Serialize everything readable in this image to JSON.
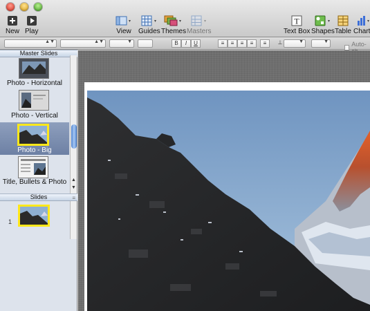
{
  "toolbar": {
    "new_label": "New",
    "play_label": "Play",
    "view_label": "View",
    "guides_label": "Guides",
    "themes_label": "Themes",
    "masters_label": "Masters",
    "textbox_label": "Text Box",
    "textbox_icon_glyph": "T",
    "shapes_label": "Shapes",
    "table_label": "Table",
    "charts_label": "Charts"
  },
  "formatbar": {
    "bold": "B",
    "italic": "I",
    "underline": "U",
    "autoshrink_label": "Auto-sh"
  },
  "sidebar": {
    "master_header": "Master Slides",
    "masters": [
      {
        "label": "Photo - Horizontal"
      },
      {
        "label": "Photo - Vertical"
      },
      {
        "label": "Photo - Big",
        "selected": true
      },
      {
        "label": "Title, Bullets & Photo"
      }
    ],
    "slides_header": "Slides",
    "slides": [
      {
        "number": "1",
        "selected": true
      }
    ]
  },
  "colors": {
    "selection_yellow": "#ffe81a",
    "sidebar_bg": "#dde3ec",
    "selected_row": "#7386a9",
    "sky": "#8fb0d2"
  },
  "icons": {
    "new": "plus-icon",
    "play": "play-icon",
    "view": "view-icon",
    "guides": "grid-icon",
    "themes": "themes-icon",
    "masters": "masters-icon",
    "textbox": "textbox-icon",
    "shapes": "shapes-icon",
    "table": "table-icon",
    "charts": "bar-chart-icon"
  }
}
